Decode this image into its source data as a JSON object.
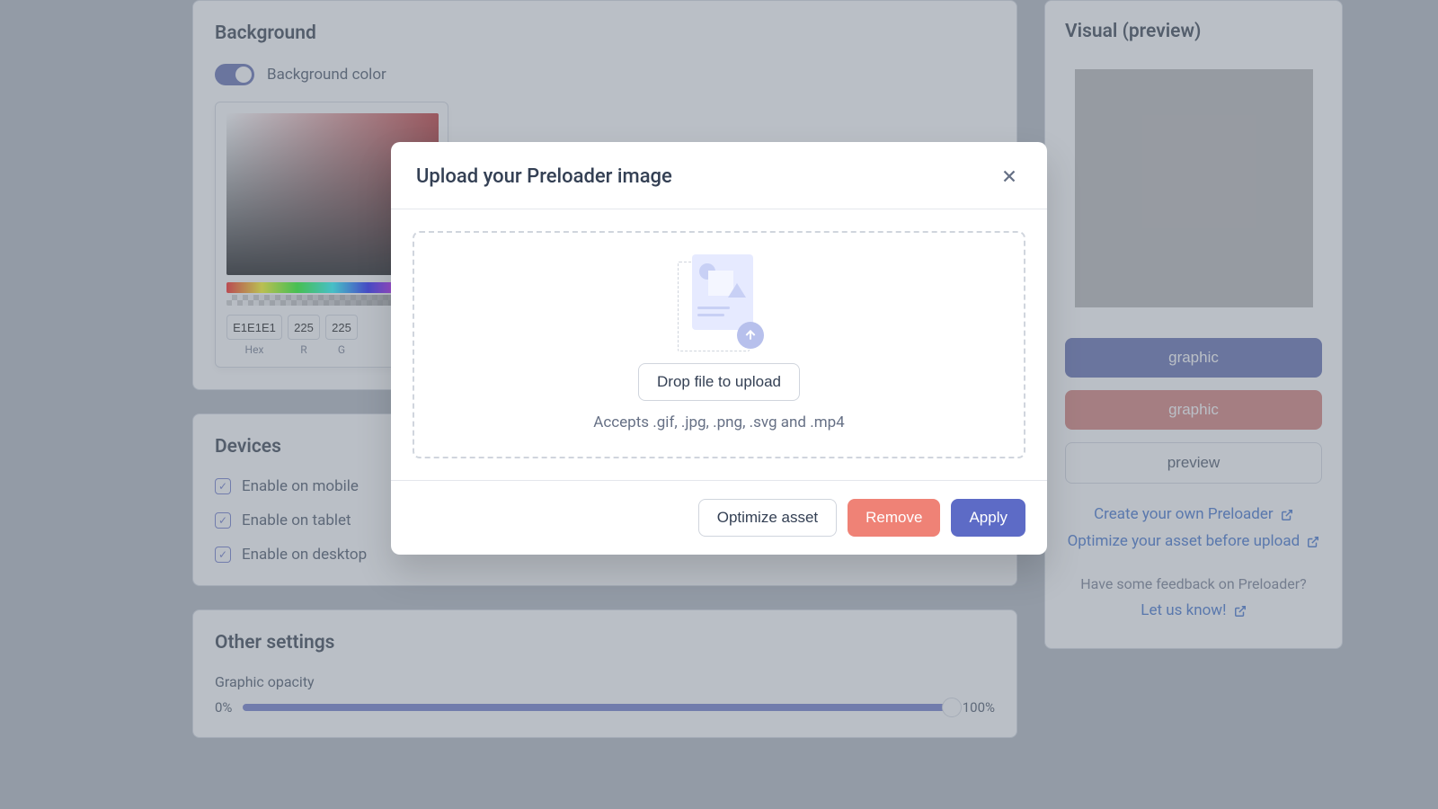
{
  "background": {
    "title": "Background",
    "toggle_label": "Background color",
    "hex_value": "E1E1E1",
    "r_value": "225",
    "g_value": "225",
    "hex_label": "Hex",
    "r_label": "R",
    "g_label": "G"
  },
  "devices": {
    "title": "Devices",
    "mobile_label": "Enable on mobile",
    "tablet_label": "Enable on tablet",
    "desktop_label": "Enable on desktop"
  },
  "other": {
    "title": "Other settings",
    "opacity_label": "Graphic opacity",
    "opacity_min": "0%",
    "opacity_val": "100%"
  },
  "visual": {
    "title": "Visual (preview)",
    "upload_btn_trailing": "graphic",
    "remove_btn_trailing": "graphic",
    "preview_btn_trailing": "preview"
  },
  "links": {
    "create": "Create your own Preloader",
    "optimize": "Optimize your asset before upload"
  },
  "feedback": {
    "prompt": "Have some feedback on Preloader?",
    "cta": "Let us know!"
  },
  "modal": {
    "title": "Upload your Preloader image",
    "drop_btn": "Drop file to upload",
    "accepts": "Accepts .gif, .jpg, .png, .svg and .mp4",
    "optimize": "Optimize asset",
    "remove": "Remove",
    "apply": "Apply"
  }
}
